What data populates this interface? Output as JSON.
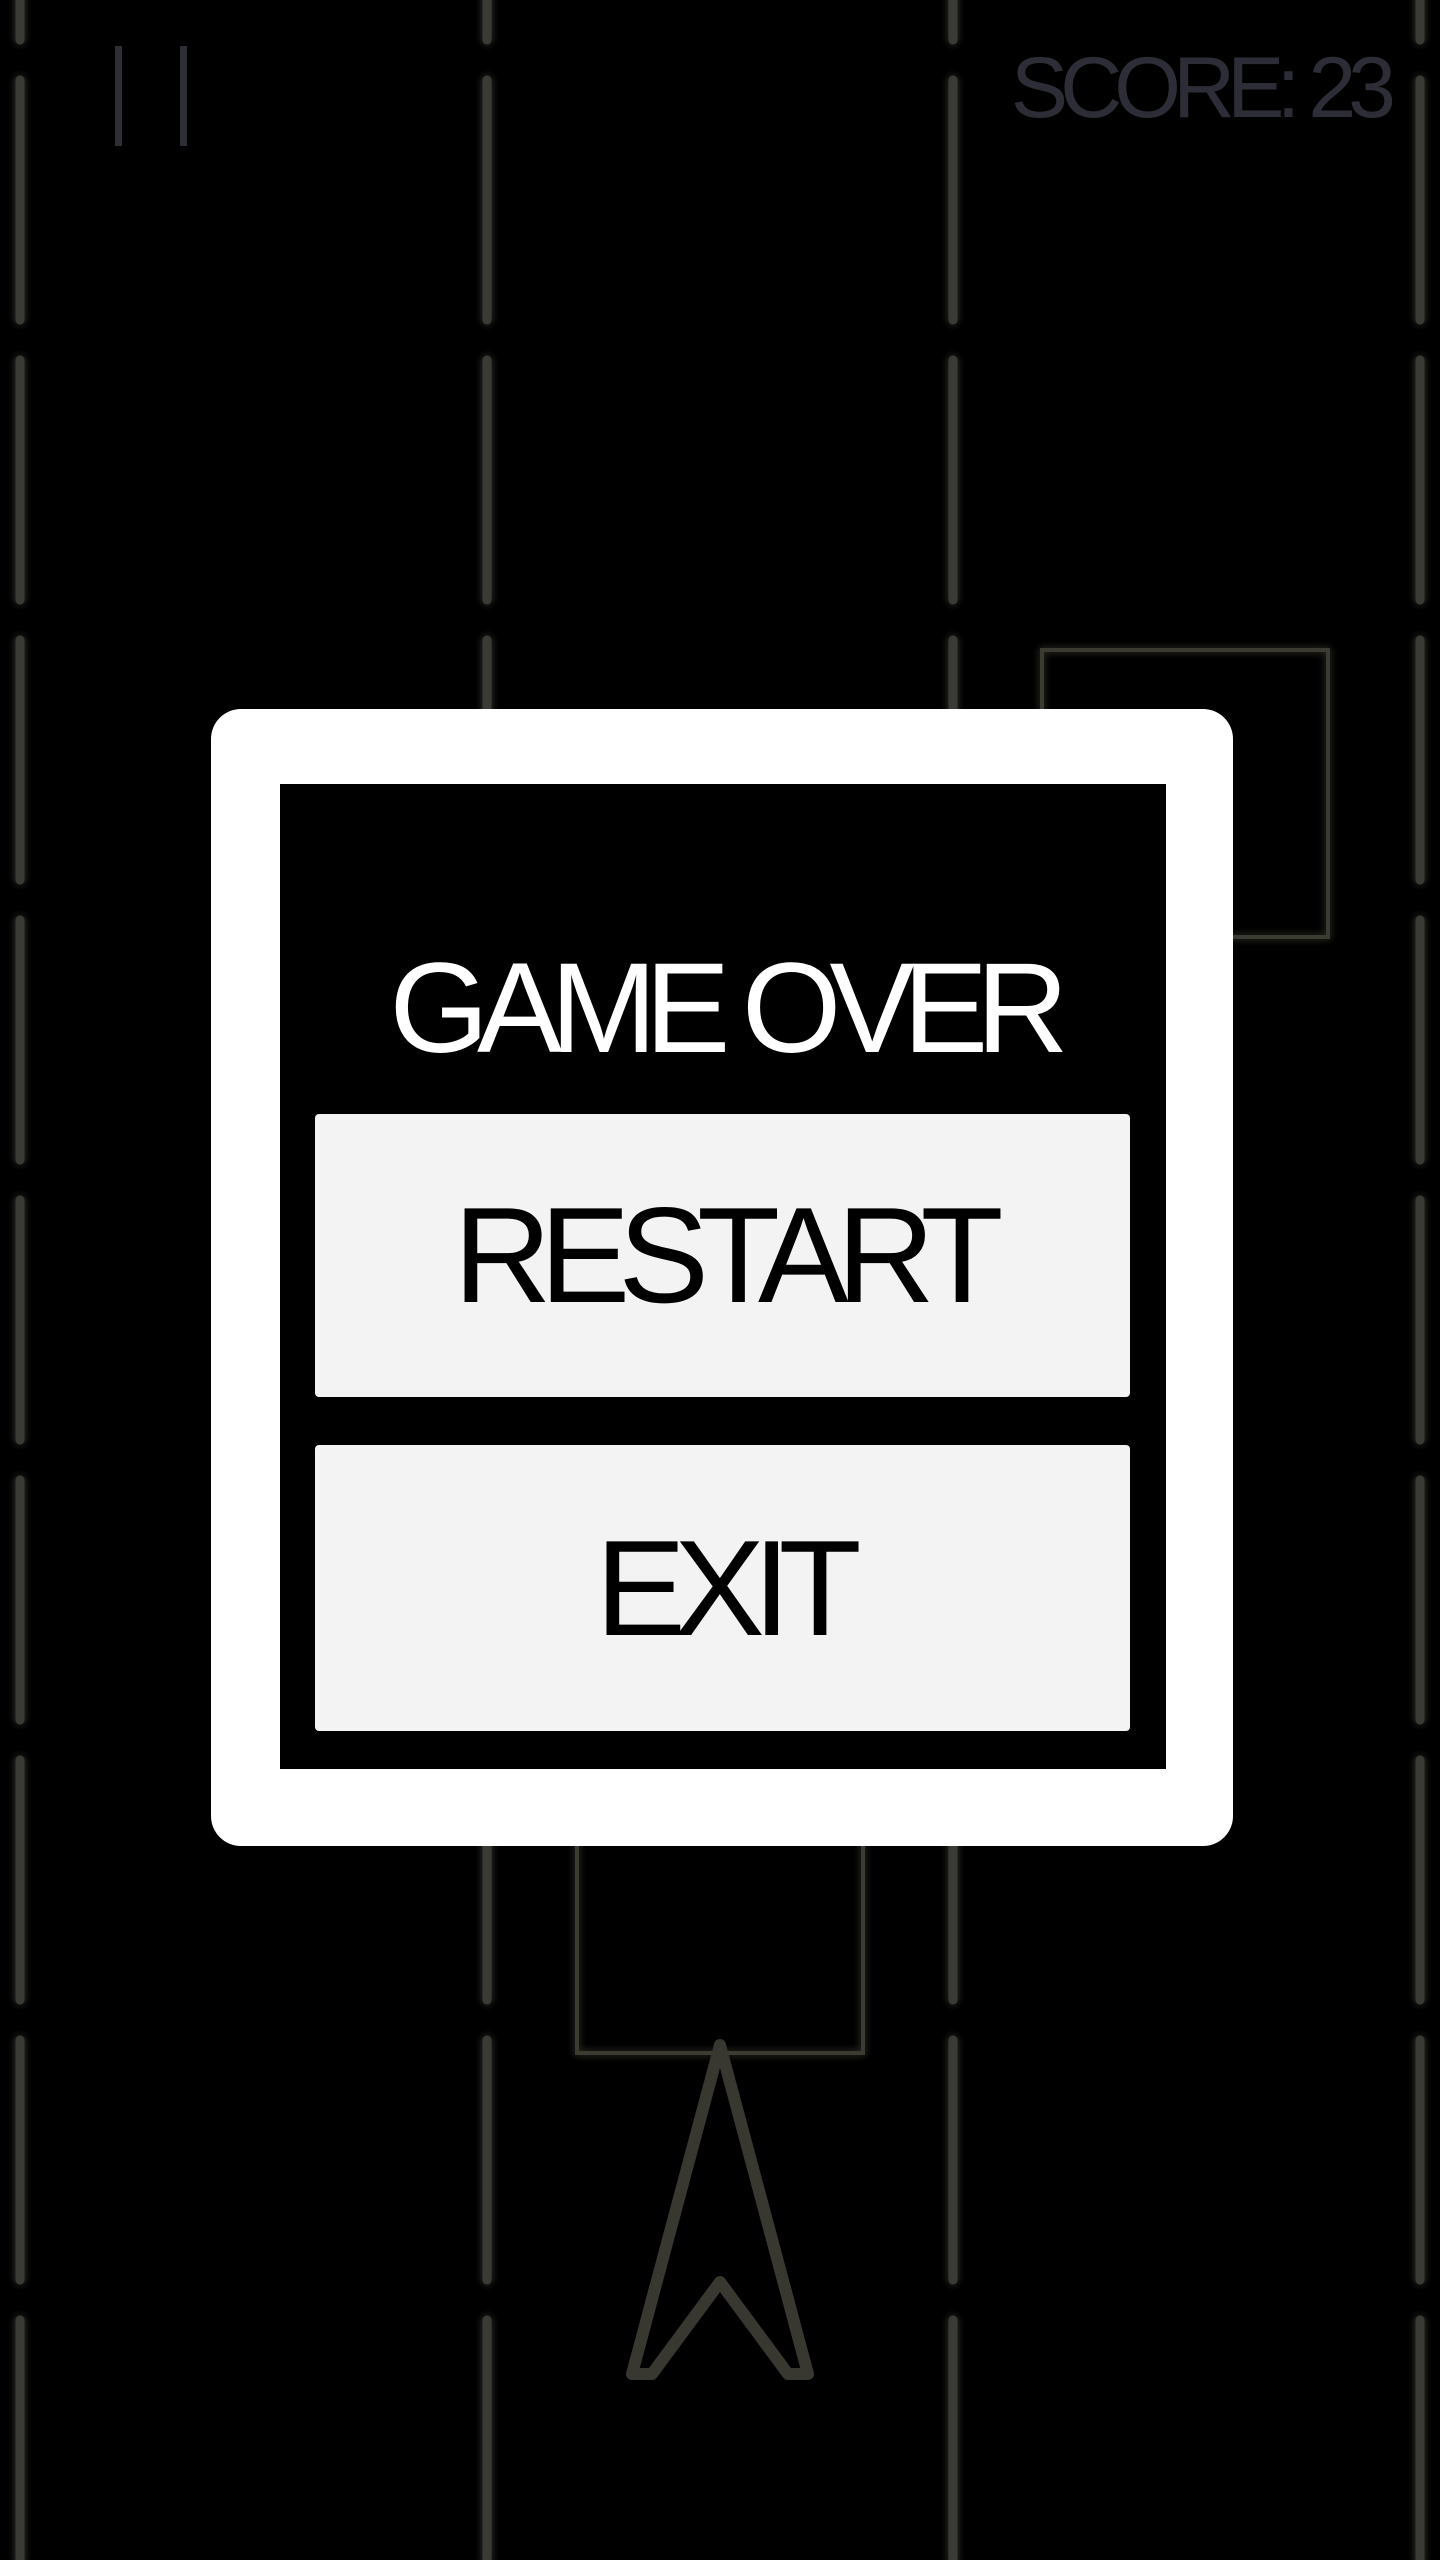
{
  "hud": {
    "pause_icon": "pause-icon",
    "score_text": "SCORE: 23"
  },
  "dialog": {
    "title": "GAME OVER",
    "restart_label": "RESTART",
    "exit_label": "EXIT"
  },
  "colors": {
    "background": "#000000",
    "dialog_frame": "#ffffff",
    "button_fill": "#f3f3f3",
    "hud_text": "#2d2d37",
    "lane_line": "#3a3a35",
    "obstacle_outline": "#3b3b33",
    "player_ship_outline": "#383830"
  }
}
